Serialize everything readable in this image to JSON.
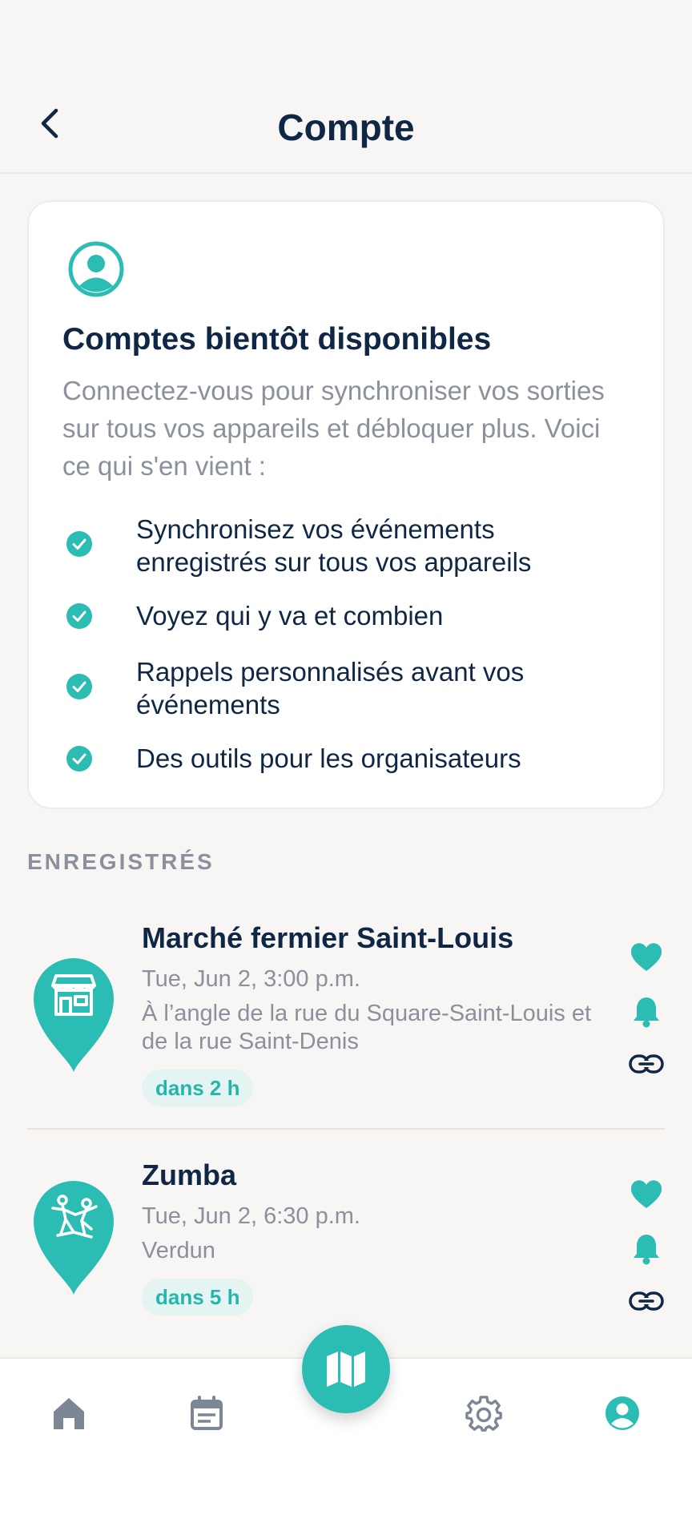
{
  "header": {
    "title": "Compte"
  },
  "card": {
    "title": "Comptes bientôt disponibles",
    "description": "Connectez-vous pour synchroniser vos sorties sur tous vos appareils et débloquer plus. Voici ce qui s'en vient :",
    "features": [
      "Synchronisez vos événements enregistrés sur tous vos appareils",
      "Voyez qui y va et combien",
      "Rappels personnalisés avant vos événements",
      "Des outils pour les organisateurs"
    ]
  },
  "saved": {
    "label": "ENREGISTRÉS",
    "events": [
      {
        "title": "Marché fermier Saint-Louis",
        "date": "Tue, Jun 2, 3:00 p.m.",
        "location": "À l’angle de la rue du Square-Saint-Louis et de la rue Saint-Denis",
        "badge": "dans 2 h",
        "icon": "storefront-icon"
      },
      {
        "title": "Zumba",
        "date": "Tue, Jun 2, 6:30 p.m.",
        "location": "Verdun",
        "badge": "dans 5 h",
        "icon": "dancers-icon"
      }
    ]
  },
  "nav": {
    "items": [
      "home-icon",
      "calendar-icon",
      "map-icon",
      "settings-icon",
      "account-icon"
    ],
    "active": "account-icon"
  },
  "colors": {
    "accent": "#2bbcb3",
    "text_dark": "#0f2744",
    "text_muted": "#8a909c",
    "background": "#f8f6f4",
    "badge_bg": "#e3f4f2"
  }
}
